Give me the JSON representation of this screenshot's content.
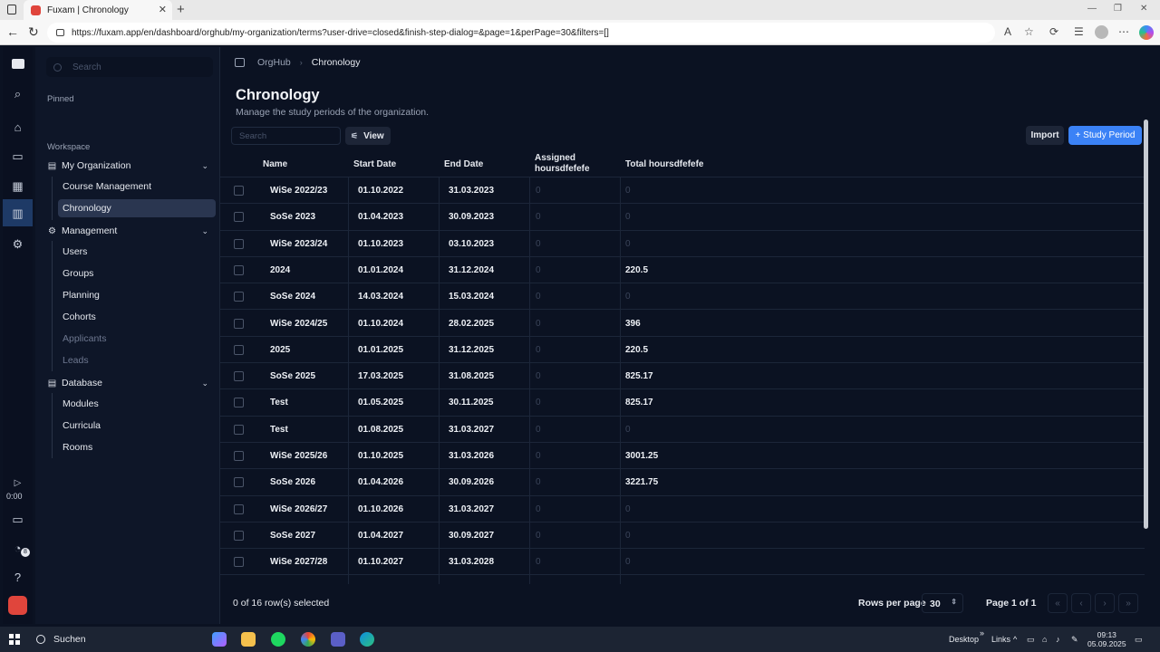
{
  "browser": {
    "tab_title": "Fuxam | Chronology",
    "url": "https://fuxam.app/en/dashboard/orghub/my-organization/terms?user-drive=closed&finish-step-dialog=&page=1&perPage=30&filters=[]"
  },
  "rail": {
    "timer": "0:00",
    "notification_count": "8"
  },
  "sidebar": {
    "search_placeholder": "Search",
    "pinned_label": "Pinned",
    "workspace_label": "Workspace",
    "groups": [
      {
        "label": "My Organization",
        "items": [
          "Course Management",
          "Chronology"
        ]
      },
      {
        "label": "Management",
        "items": [
          "Users",
          "Groups",
          "Planning",
          "Cohorts",
          "Applicants",
          "Leads"
        ]
      },
      {
        "label": "Database",
        "items": [
          "Modules",
          "Curricula",
          "Rooms"
        ]
      }
    ]
  },
  "breadcrumb": {
    "root": "OrgHub",
    "current": "Chronology"
  },
  "page": {
    "title": "Chronology",
    "subtitle": "Manage the study periods of the organization.",
    "search_placeholder": "Search",
    "view_label": "View",
    "import_label": "Import",
    "add_label": "Study Period"
  },
  "table": {
    "columns": [
      "Name",
      "Start Date",
      "End Date",
      "Assigned hoursdfefefe",
      "Total hoursdfefefe"
    ],
    "assigned_header_lines": [
      "Assigned",
      "hoursdfefefe"
    ],
    "rows": [
      {
        "name": "WiSe 2022/23",
        "start": "01.10.2022",
        "end": "31.03.2023",
        "assigned": "0",
        "total": "0"
      },
      {
        "name": "SoSe 2023",
        "start": "01.04.2023",
        "end": "30.09.2023",
        "assigned": "0",
        "total": "0"
      },
      {
        "name": "WiSe 2023/24",
        "start": "01.10.2023",
        "end": "03.10.2023",
        "assigned": "0",
        "total": "0"
      },
      {
        "name": "2024",
        "start": "01.01.2024",
        "end": "31.12.2024",
        "assigned": "0",
        "total": "220.5"
      },
      {
        "name": "SoSe 2024",
        "start": "14.03.2024",
        "end": "15.03.2024",
        "assigned": "0",
        "total": "0"
      },
      {
        "name": "WiSe 2024/25",
        "start": "01.10.2024",
        "end": "28.02.2025",
        "assigned": "0",
        "total": "396"
      },
      {
        "name": "2025",
        "start": "01.01.2025",
        "end": "31.12.2025",
        "assigned": "0",
        "total": "220.5"
      },
      {
        "name": "SoSe 2025",
        "start": "17.03.2025",
        "end": "31.08.2025",
        "assigned": "0",
        "total": "825.17"
      },
      {
        "name": "Test",
        "start": "01.05.2025",
        "end": "30.11.2025",
        "assigned": "0",
        "total": "825.17"
      },
      {
        "name": "Test",
        "start": "01.08.2025",
        "end": "31.03.2027",
        "assigned": "0",
        "total": "0"
      },
      {
        "name": "WiSe 2025/26",
        "start": "01.10.2025",
        "end": "31.03.2026",
        "assigned": "0",
        "total": "3001.25"
      },
      {
        "name": "SoSe 2026",
        "start": "01.04.2026",
        "end": "30.09.2026",
        "assigned": "0",
        "total": "3221.75"
      },
      {
        "name": "WiSe 2026/27",
        "start": "01.10.2026",
        "end": "31.03.2027",
        "assigned": "0",
        "total": "0"
      },
      {
        "name": "SoSe 2027",
        "start": "01.04.2027",
        "end": "30.09.2027",
        "assigned": "0",
        "total": "0"
      },
      {
        "name": "WiSe 2027/28",
        "start": "01.10.2027",
        "end": "31.03.2028",
        "assigned": "0",
        "total": "0"
      }
    ]
  },
  "footer": {
    "selection": "0 of 16 row(s) selected",
    "rows_per_page_label": "Rows per page",
    "rows_per_page_value": "30",
    "page_info": "Page 1 of 1"
  },
  "taskbar": {
    "search_label": "Suchen",
    "desktop_label": "Desktop",
    "links_label": "Links",
    "time": "09:13",
    "date": "05.09.2025"
  },
  "colors": {
    "accent": "#3b82f6",
    "background": "#0b1222",
    "brand": "#e0453c"
  }
}
